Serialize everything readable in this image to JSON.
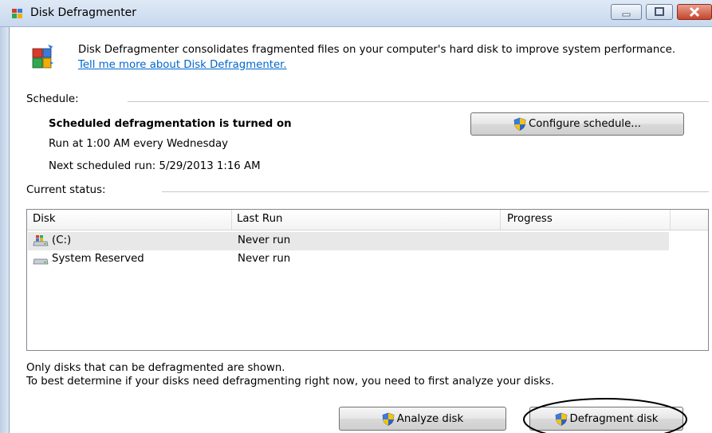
{
  "window": {
    "title": "Disk Defragmenter"
  },
  "header": {
    "description": "Disk Defragmenter consolidates fragmented files on your computer's hard disk to improve system performance.",
    "link": "Tell me more about Disk Defragmenter."
  },
  "schedule": {
    "label": "Schedule:",
    "status": "Scheduled defragmentation is turned on",
    "run_at": "Run at 1:00 AM every Wednesday",
    "next_run": "Next scheduled run: 5/29/2013 1:16 AM",
    "configure_button": "Configure schedule..."
  },
  "status": {
    "label": "Current status:",
    "columns": [
      "Disk",
      "Last Run",
      "Progress"
    ],
    "rows": [
      {
        "disk": "(C:)",
        "last_run": "Never run",
        "progress": "",
        "icon": "system-drive-icon"
      },
      {
        "disk": "System Reserved",
        "last_run": "Never run",
        "progress": "",
        "icon": "drive-icon"
      }
    ]
  },
  "notes": {
    "line1": "Only disks that can be defragmented are shown.",
    "line2": "To best determine if your disks need defragmenting right now, you need to first analyze your disks."
  },
  "buttons": {
    "analyze": "Analyze disk",
    "defragment": "Defragment disk"
  },
  "colors": {
    "link": "#0066cc",
    "close_button": "#c6452c",
    "selection": "#e8e8e8"
  }
}
